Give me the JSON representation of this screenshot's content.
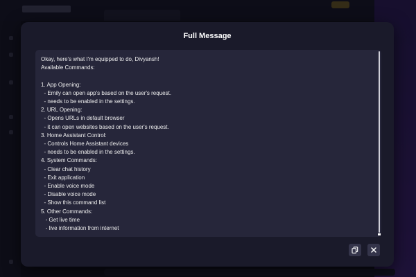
{
  "modal": {
    "title": "Full Message",
    "message": "Okay, here's what I'm equipped to do, Divyansh!\nAvailable Commands:\n\n1. App Opening:\n  - Emily can open app's based on the user's request.\n  - needs to be enabled in the settings.\n2. URL Opening:\n  - Opens URLs in default browser\n  - it can open websites based on the user's request.\n3. Home Assistant Control:\n  - Controls Home Assistant devices\n  - needs to be enabled in the settings.\n4. System Commands:\n  - Clear chat history\n  - Exit application\n  - Enable voice mode\n  - Disable voice mode\n  - Show this command list\n5. Other Commands:\n   - Get live time\n   - live information from internet",
    "actions": {
      "copy_icon": "copy-icon",
      "close_icon": "close-icon"
    }
  },
  "colors": {
    "modal_bg": "#1a1a2a",
    "message_bg": "#26263a",
    "text": "#eeeeee"
  }
}
